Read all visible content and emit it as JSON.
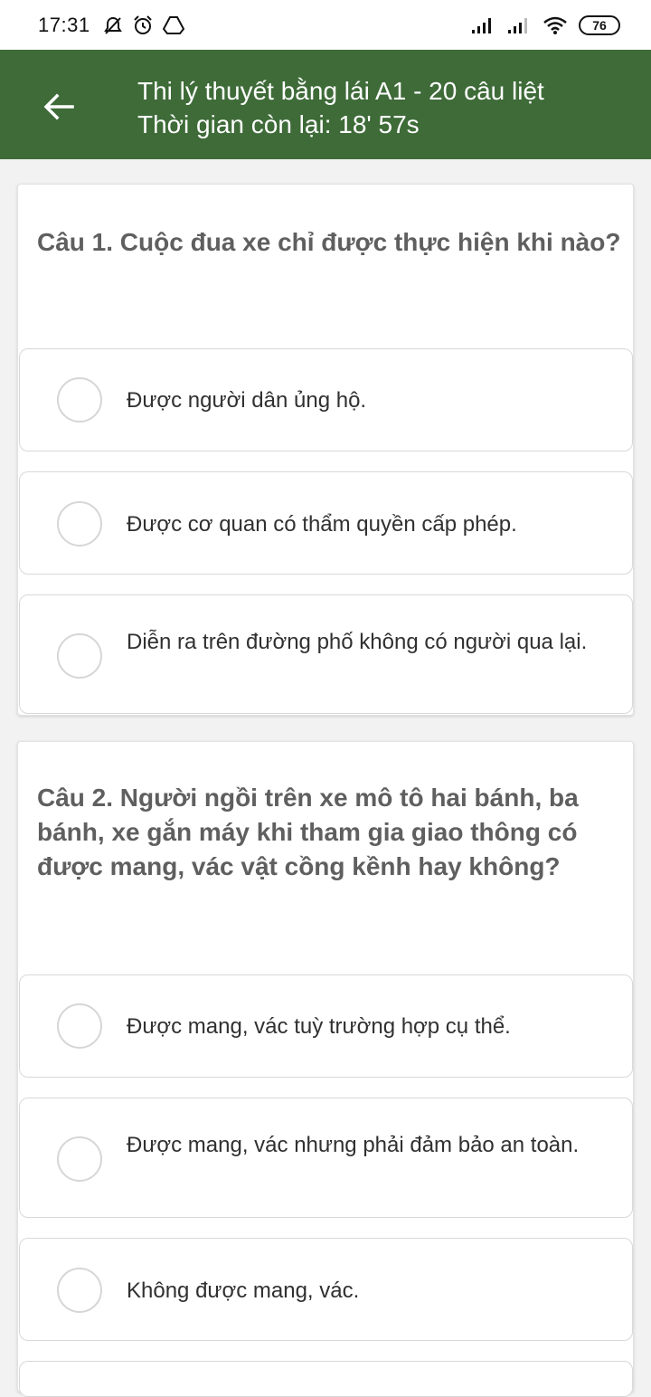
{
  "status_bar": {
    "time": "17:31",
    "icons_left": [
      "mute-icon",
      "alarm-icon",
      "drive-icon"
    ],
    "icons_right": [
      "signal-icon",
      "signal-icon",
      "wifi-icon"
    ],
    "battery": "76"
  },
  "app_bar": {
    "title": "Thi lý thuyết bằng lái A1 - 20 câu liệt",
    "subtitle": "Thời gian còn lại: 18' 57s",
    "color": "#3e6b38"
  },
  "questions": [
    {
      "text": "Câu 1.  Cuộc đua xe chỉ được thực hiện khi nào?",
      "answers": [
        "Được người dân ủng hộ.",
        "Được cơ quan có thẩm quyền cấp phép.",
        "Diễn ra trên đường phố không có người qua lại."
      ]
    },
    {
      "text": "Câu 2.  Người ngồi trên xe mô tô hai bánh, ba bánh, xe gắn máy khi tham gia giao thông có được mang, vác vật cồng kềnh hay không?",
      "answers": [
        "Được mang, vác tuỳ trường hợp cụ thể.",
        "Được mang, vác nhưng phải đảm bảo an toàn.",
        "Không được mang, vác."
      ]
    }
  ]
}
